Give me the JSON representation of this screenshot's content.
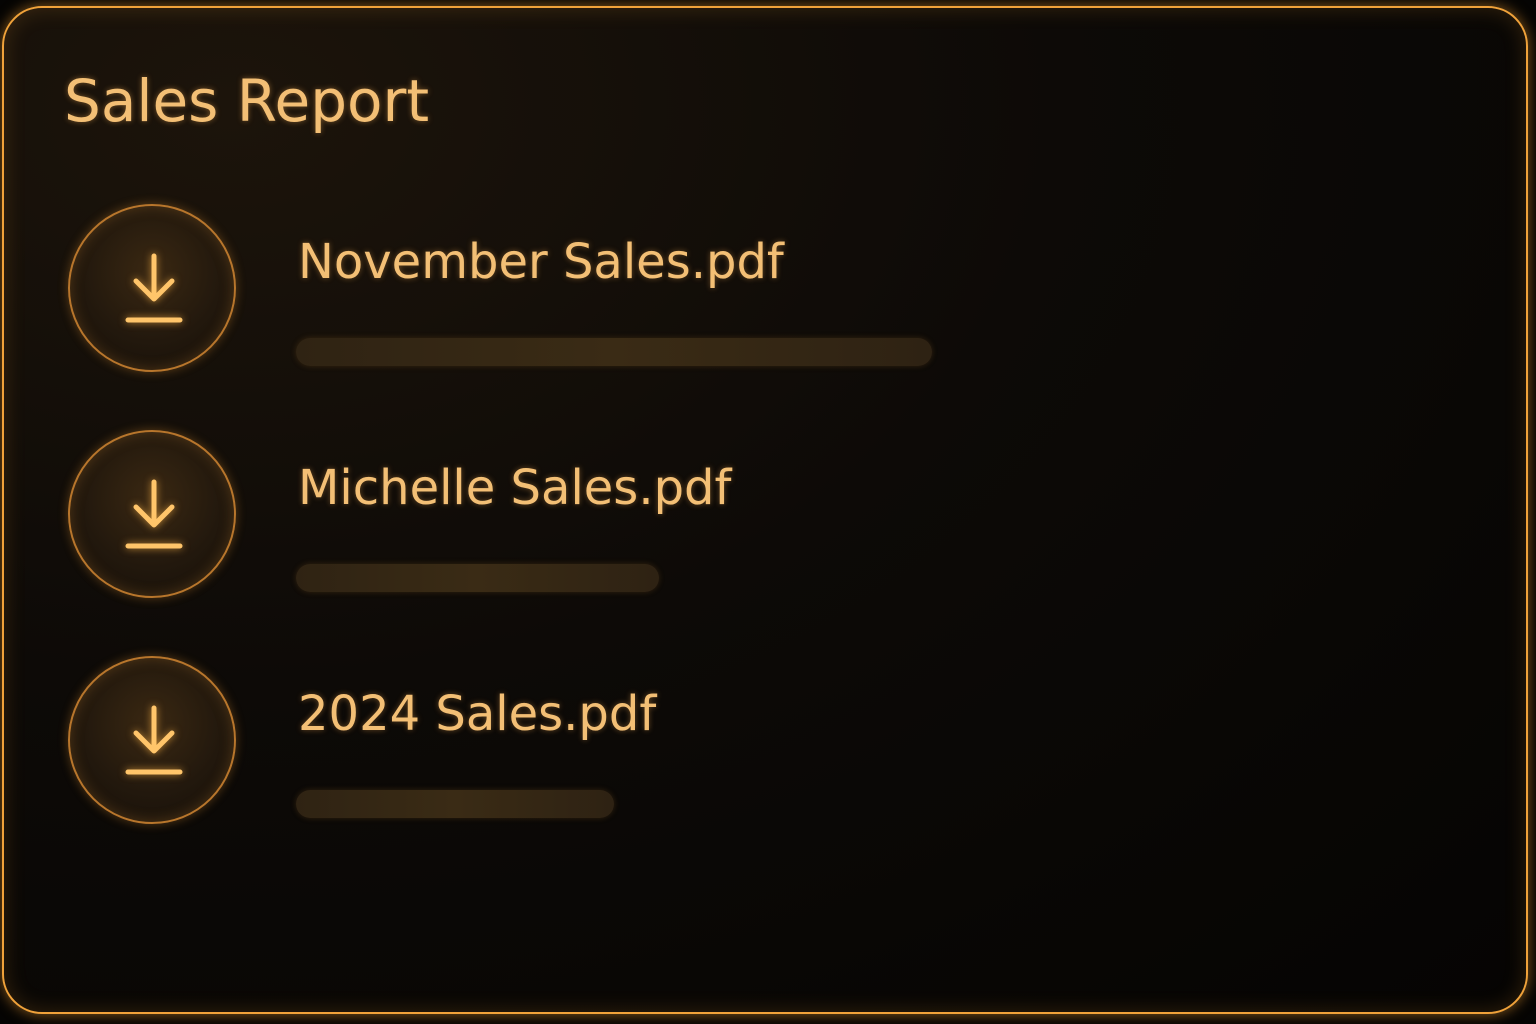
{
  "panel": {
    "title": "Sales Report"
  },
  "files": [
    {
      "name": "November Sales.pdf",
      "progress": 1.0,
      "icon": "download-icon"
    },
    {
      "name": "Michelle Sales.pdf",
      "progress": 0.57,
      "icon": "download-icon"
    },
    {
      "name": "2024 Sales.pdf",
      "progress": 0.5,
      "icon": "download-icon"
    }
  ],
  "colors": {
    "accent": "#f0a23a",
    "text": "#f3bf75",
    "background": "#050403"
  }
}
